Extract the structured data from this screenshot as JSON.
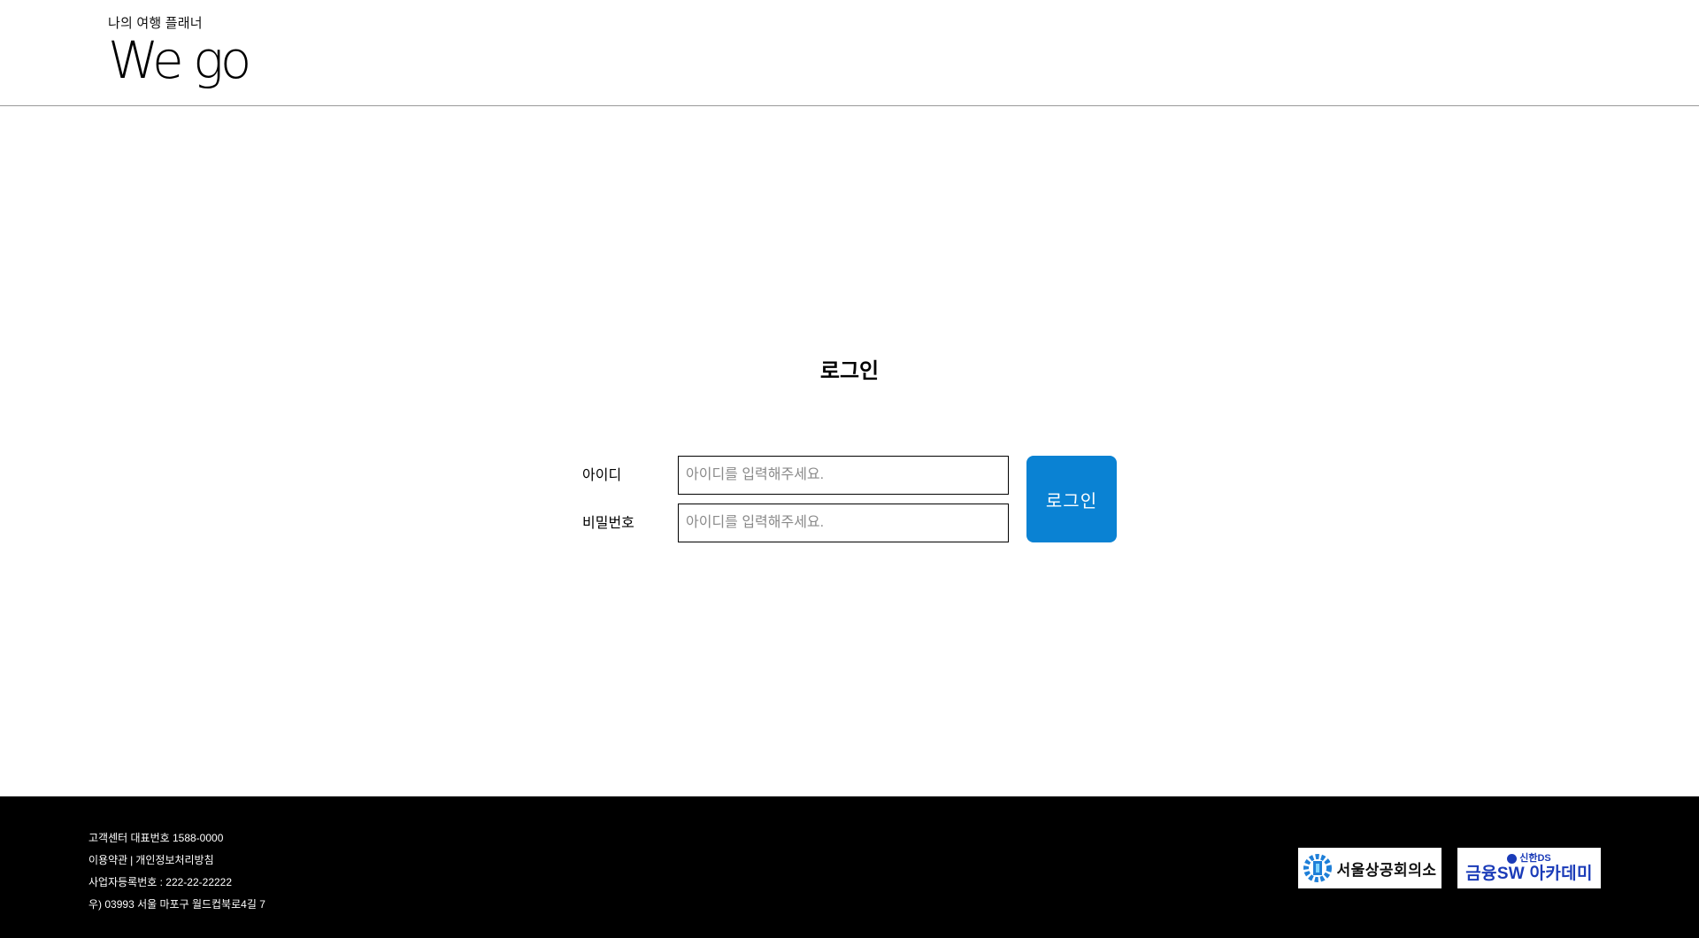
{
  "header": {
    "tagline": "나의 여행 플래너",
    "logo_text": "We go"
  },
  "login": {
    "title": "로그인",
    "id_label": "아이디",
    "id_placeholder": "아이디를 입력해주세요.",
    "id_value": "",
    "password_label": "비밀번호",
    "password_placeholder": "아이디를 입력해주세요.",
    "password_value": "",
    "button_label": "로그인"
  },
  "footer": {
    "customer_center": "고객센터 대표번호 1588-0000",
    "terms_link": "이용약관",
    "separator": "|",
    "privacy_link": "개인정보처리방침",
    "business_number": "사업자등록번호 : 222-22-22222",
    "address": "우) 03993 서울 마포구 월드컵북로4길 7"
  },
  "partners": {
    "chamber_name": "서울상공회의소",
    "academy_brand": "신한DS",
    "academy_name": "금융SW 아카데미"
  },
  "colors": {
    "accent": "#0a82d3",
    "footer_bg": "#000000",
    "partner_blue": "#1a3bb8"
  },
  "icons": {
    "chamber_logo": "seoul-chamber-logo-icon",
    "academy_logo": "shinhan-ds-logo-icon"
  }
}
